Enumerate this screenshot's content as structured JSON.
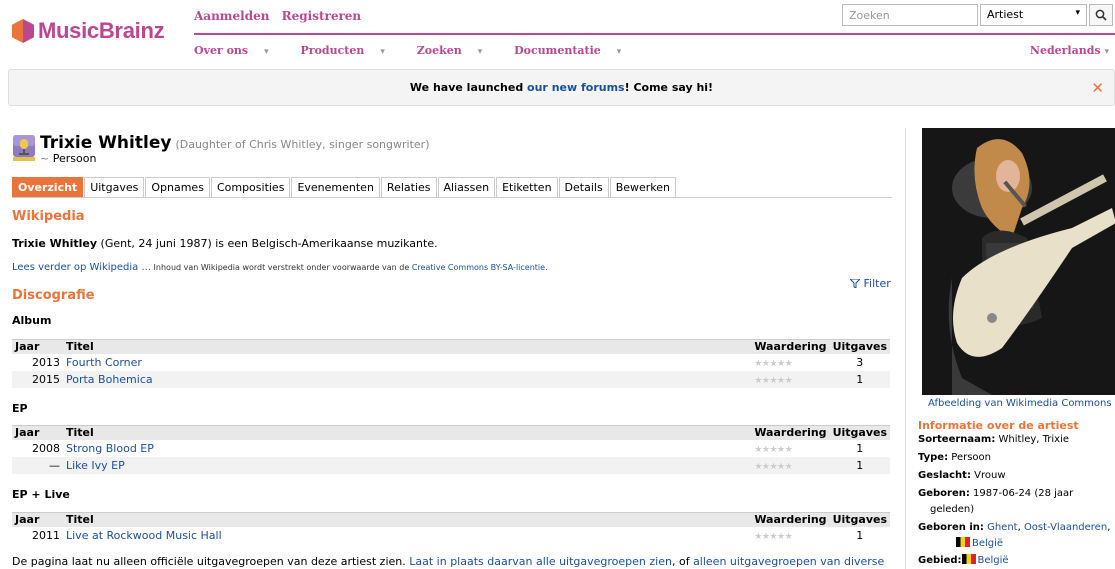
{
  "header": {
    "logo_text": "MusicBrainz",
    "auth_links": [
      "Aanmelden",
      "Registreren"
    ],
    "menu": [
      "Over ons",
      "Producten",
      "Zoeken",
      "Documentatie"
    ],
    "language": "Nederlands",
    "search": {
      "placeholder": "Zoeken",
      "type": "Artiest"
    }
  },
  "banner": {
    "text_before": "We have launched ",
    "link": "our new forums",
    "text_after": "! Come say hi!"
  },
  "artist": {
    "name": "Trixie Whitley",
    "comment": "(Daughter of Chris Whitley, singer songwriter)",
    "type_prefix": "~",
    "type": "Persoon"
  },
  "tabs": [
    "Overzicht",
    "Uitgaves",
    "Opnames",
    "Composities",
    "Evenementen",
    "Relaties",
    "Aliassen",
    "Etiketten",
    "Details",
    "Bewerken"
  ],
  "wikipedia": {
    "heading": "Wikipedia",
    "name": "Trixie Whitley",
    "text": " (Gent, 24 juni 1987) is een Belgisch-Amerikaanse muzikante.",
    "read_more": "Lees verder op Wikipedia ...",
    "license_text": " Inhoud van Wikipedia wordt verstrekt onder voorwaarde van de ",
    "license_link": "Creative Commons BY-SA-licentie",
    "license_end": "."
  },
  "discography": {
    "heading": "Discografie",
    "filter": "Filter",
    "columns": {
      "year": "Jaar",
      "title": "Titel",
      "rating": "Waardering",
      "releases": "Uitgaves"
    },
    "sections": [
      {
        "label": "Album",
        "rows": [
          {
            "year": "2013",
            "title": "Fourth Corner",
            "count": "3"
          },
          {
            "year": "2015",
            "title": "Porta Bohemica",
            "count": "1"
          }
        ]
      },
      {
        "label": "EP",
        "rows": [
          {
            "year": "2008",
            "title": "Strong Blood EP",
            "count": "1"
          },
          {
            "year": "—",
            "title": "Like Ivy EP",
            "count": "1"
          }
        ]
      },
      {
        "label": "EP + Live",
        "rows": [
          {
            "year": "2011",
            "title": "Live at Rockwood Music Hall",
            "count": "1"
          }
        ]
      }
    ],
    "stars": "★★★★★"
  },
  "footer": {
    "text": "De pagina laat nu alleen officiële uitgavegroepen van deze artiest zien. ",
    "link1": "Laat in plaats daarvan alle uitgavegroepen zien",
    "mid": ", of ",
    "link2": "alleen uitgavegroepen van diverse"
  },
  "sidebar": {
    "caption": "Afbeelding van Wikimedia Commons",
    "heading": "Informatie over de artiest",
    "sort_label": "Sorteernaam:",
    "sort_value": "Whitley, Trixie",
    "type_label": "Type:",
    "type_value": "Persoon",
    "gender_label": "Geslacht:",
    "gender_value": "Vrouw",
    "born_label": "Geboren:",
    "born_value": "1987-06-24 (28 jaar",
    "born_value2": "geleden)",
    "born_in_label": "Geboren in:",
    "born_in_city": "Ghent",
    "born_in_region": "Oost-Vlaanderen",
    "born_in_country": "België",
    "area_label": "Gebied:",
    "area_value": "België"
  },
  "colors": {
    "brand_purple": "#ba478f",
    "brand_orange": "#eb743b",
    "link_blue": "#1a4f9b"
  }
}
